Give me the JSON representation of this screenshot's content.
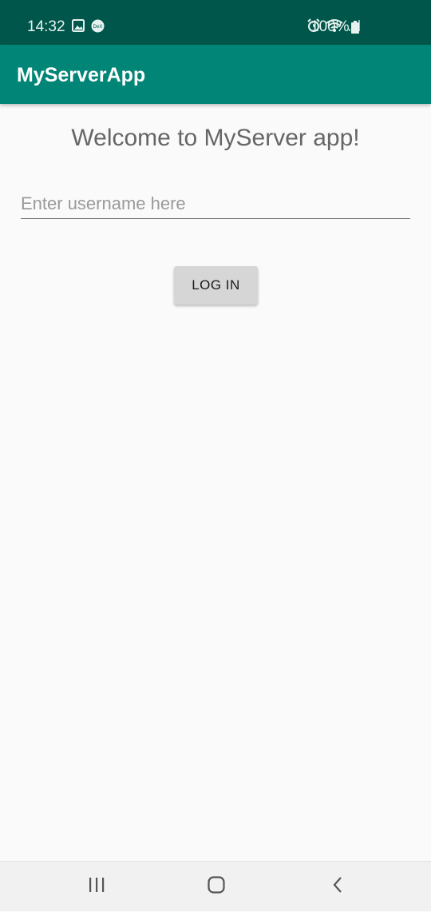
{
  "status_bar": {
    "time": "14:32",
    "battery": "100%",
    "left_icons": [
      "image-icon",
      "dex-icon"
    ],
    "right_icons": [
      "alarm-icon",
      "wifi-icon",
      "signal-icon",
      "battery-icon"
    ]
  },
  "app_bar": {
    "title": "MyServerApp",
    "color": "#008577"
  },
  "main": {
    "welcome": "Welcome to MyServer app!",
    "username": {
      "value": "",
      "placeholder": "Enter username here"
    },
    "login_label": "LOG IN"
  },
  "nav_bar": {
    "buttons": [
      "recent-apps-icon",
      "home-icon",
      "back-icon"
    ]
  },
  "colors": {
    "status_bar": "#00564a",
    "app_bar": "#008577",
    "background": "#fafafa",
    "button": "#d6d6d6"
  }
}
